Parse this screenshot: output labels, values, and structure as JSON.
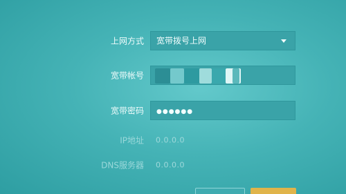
{
  "connection_type": {
    "label": "上网方式",
    "selected": "宽带拨号上网"
  },
  "account": {
    "label": "宽带帐号"
  },
  "password": {
    "label": "宽带密码",
    "value": "●●●●●●"
  },
  "ip": {
    "label": "IP地址",
    "value": "0.0.0.0"
  },
  "dns": {
    "label": "DNS服务器",
    "value": "0.0.0.0"
  },
  "colors": {
    "background": "#45b3b6",
    "field": "#3aa3a8",
    "text": "#eefbfb",
    "dim_text": "#9ad8da"
  }
}
